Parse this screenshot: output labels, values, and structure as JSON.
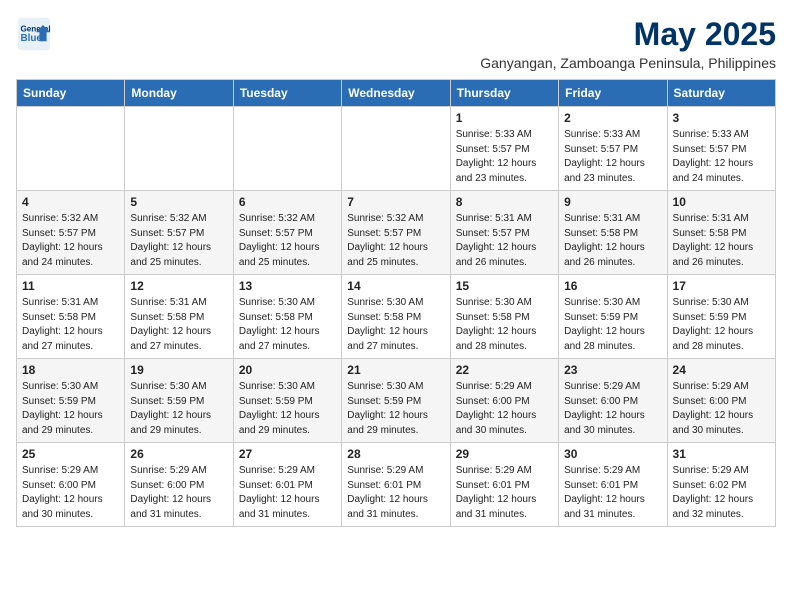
{
  "header": {
    "logo_line1": "General",
    "logo_line2": "Blue",
    "month_title": "May 2025",
    "subtitle": "Ganyangan, Zamboanga Peninsula, Philippines"
  },
  "weekdays": [
    "Sunday",
    "Monday",
    "Tuesday",
    "Wednesday",
    "Thursday",
    "Friday",
    "Saturday"
  ],
  "weeks": [
    [
      {
        "day": "",
        "info": ""
      },
      {
        "day": "",
        "info": ""
      },
      {
        "day": "",
        "info": ""
      },
      {
        "day": "",
        "info": ""
      },
      {
        "day": "1",
        "info": "Sunrise: 5:33 AM\nSunset: 5:57 PM\nDaylight: 12 hours\nand 23 minutes."
      },
      {
        "day": "2",
        "info": "Sunrise: 5:33 AM\nSunset: 5:57 PM\nDaylight: 12 hours\nand 23 minutes."
      },
      {
        "day": "3",
        "info": "Sunrise: 5:33 AM\nSunset: 5:57 PM\nDaylight: 12 hours\nand 24 minutes."
      }
    ],
    [
      {
        "day": "4",
        "info": "Sunrise: 5:32 AM\nSunset: 5:57 PM\nDaylight: 12 hours\nand 24 minutes."
      },
      {
        "day": "5",
        "info": "Sunrise: 5:32 AM\nSunset: 5:57 PM\nDaylight: 12 hours\nand 25 minutes."
      },
      {
        "day": "6",
        "info": "Sunrise: 5:32 AM\nSunset: 5:57 PM\nDaylight: 12 hours\nand 25 minutes."
      },
      {
        "day": "7",
        "info": "Sunrise: 5:32 AM\nSunset: 5:57 PM\nDaylight: 12 hours\nand 25 minutes."
      },
      {
        "day": "8",
        "info": "Sunrise: 5:31 AM\nSunset: 5:57 PM\nDaylight: 12 hours\nand 26 minutes."
      },
      {
        "day": "9",
        "info": "Sunrise: 5:31 AM\nSunset: 5:58 PM\nDaylight: 12 hours\nand 26 minutes."
      },
      {
        "day": "10",
        "info": "Sunrise: 5:31 AM\nSunset: 5:58 PM\nDaylight: 12 hours\nand 26 minutes."
      }
    ],
    [
      {
        "day": "11",
        "info": "Sunrise: 5:31 AM\nSunset: 5:58 PM\nDaylight: 12 hours\nand 27 minutes."
      },
      {
        "day": "12",
        "info": "Sunrise: 5:31 AM\nSunset: 5:58 PM\nDaylight: 12 hours\nand 27 minutes."
      },
      {
        "day": "13",
        "info": "Sunrise: 5:30 AM\nSunset: 5:58 PM\nDaylight: 12 hours\nand 27 minutes."
      },
      {
        "day": "14",
        "info": "Sunrise: 5:30 AM\nSunset: 5:58 PM\nDaylight: 12 hours\nand 27 minutes."
      },
      {
        "day": "15",
        "info": "Sunrise: 5:30 AM\nSunset: 5:58 PM\nDaylight: 12 hours\nand 28 minutes."
      },
      {
        "day": "16",
        "info": "Sunrise: 5:30 AM\nSunset: 5:59 PM\nDaylight: 12 hours\nand 28 minutes."
      },
      {
        "day": "17",
        "info": "Sunrise: 5:30 AM\nSunset: 5:59 PM\nDaylight: 12 hours\nand 28 minutes."
      }
    ],
    [
      {
        "day": "18",
        "info": "Sunrise: 5:30 AM\nSunset: 5:59 PM\nDaylight: 12 hours\nand 29 minutes."
      },
      {
        "day": "19",
        "info": "Sunrise: 5:30 AM\nSunset: 5:59 PM\nDaylight: 12 hours\nand 29 minutes."
      },
      {
        "day": "20",
        "info": "Sunrise: 5:30 AM\nSunset: 5:59 PM\nDaylight: 12 hours\nand 29 minutes."
      },
      {
        "day": "21",
        "info": "Sunrise: 5:30 AM\nSunset: 5:59 PM\nDaylight: 12 hours\nand 29 minutes."
      },
      {
        "day": "22",
        "info": "Sunrise: 5:29 AM\nSunset: 6:00 PM\nDaylight: 12 hours\nand 30 minutes."
      },
      {
        "day": "23",
        "info": "Sunrise: 5:29 AM\nSunset: 6:00 PM\nDaylight: 12 hours\nand 30 minutes."
      },
      {
        "day": "24",
        "info": "Sunrise: 5:29 AM\nSunset: 6:00 PM\nDaylight: 12 hours\nand 30 minutes."
      }
    ],
    [
      {
        "day": "25",
        "info": "Sunrise: 5:29 AM\nSunset: 6:00 PM\nDaylight: 12 hours\nand 30 minutes."
      },
      {
        "day": "26",
        "info": "Sunrise: 5:29 AM\nSunset: 6:00 PM\nDaylight: 12 hours\nand 31 minutes."
      },
      {
        "day": "27",
        "info": "Sunrise: 5:29 AM\nSunset: 6:01 PM\nDaylight: 12 hours\nand 31 minutes."
      },
      {
        "day": "28",
        "info": "Sunrise: 5:29 AM\nSunset: 6:01 PM\nDaylight: 12 hours\nand 31 minutes."
      },
      {
        "day": "29",
        "info": "Sunrise: 5:29 AM\nSunset: 6:01 PM\nDaylight: 12 hours\nand 31 minutes."
      },
      {
        "day": "30",
        "info": "Sunrise: 5:29 AM\nSunset: 6:01 PM\nDaylight: 12 hours\nand 31 minutes."
      },
      {
        "day": "31",
        "info": "Sunrise: 5:29 AM\nSunset: 6:02 PM\nDaylight: 12 hours\nand 32 minutes."
      }
    ]
  ]
}
